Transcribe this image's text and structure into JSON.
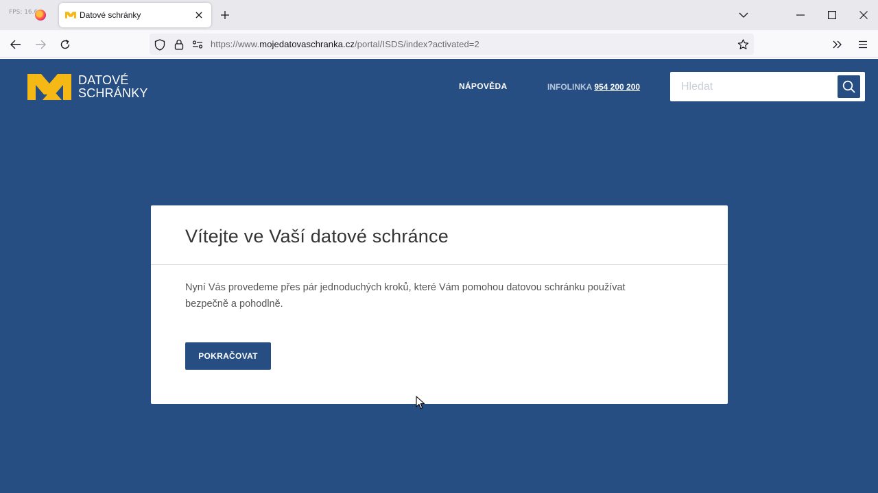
{
  "browser": {
    "fps_label": "FPS: 16.6",
    "tab": {
      "title": "Datové schránky"
    },
    "url": {
      "prefix": "https://www.",
      "host": "mojedatovaschranka.cz",
      "path": "/portal/ISDS/index?activated=2"
    }
  },
  "header": {
    "logo_line1": "DATOVÉ",
    "logo_line2": "SCHRÁNKY",
    "help_label": "NÁPOVĚDA",
    "infolinka_label": "INFOLINKA",
    "infolinka_phone": "954 200 200",
    "search_placeholder": "Hledat"
  },
  "card": {
    "title": "Vítejte ve Vaší datové schránce",
    "text": "Nyní Vás provedeme přes pár jednoduchých kroků, které Vám pomohou datovou schránku používat bezpečně a pohodlně.",
    "button_label": "POKRAČOVAT"
  },
  "colors": {
    "page_background": "#264e82",
    "logo_accent": "#f5b814",
    "button": "#264e82"
  }
}
